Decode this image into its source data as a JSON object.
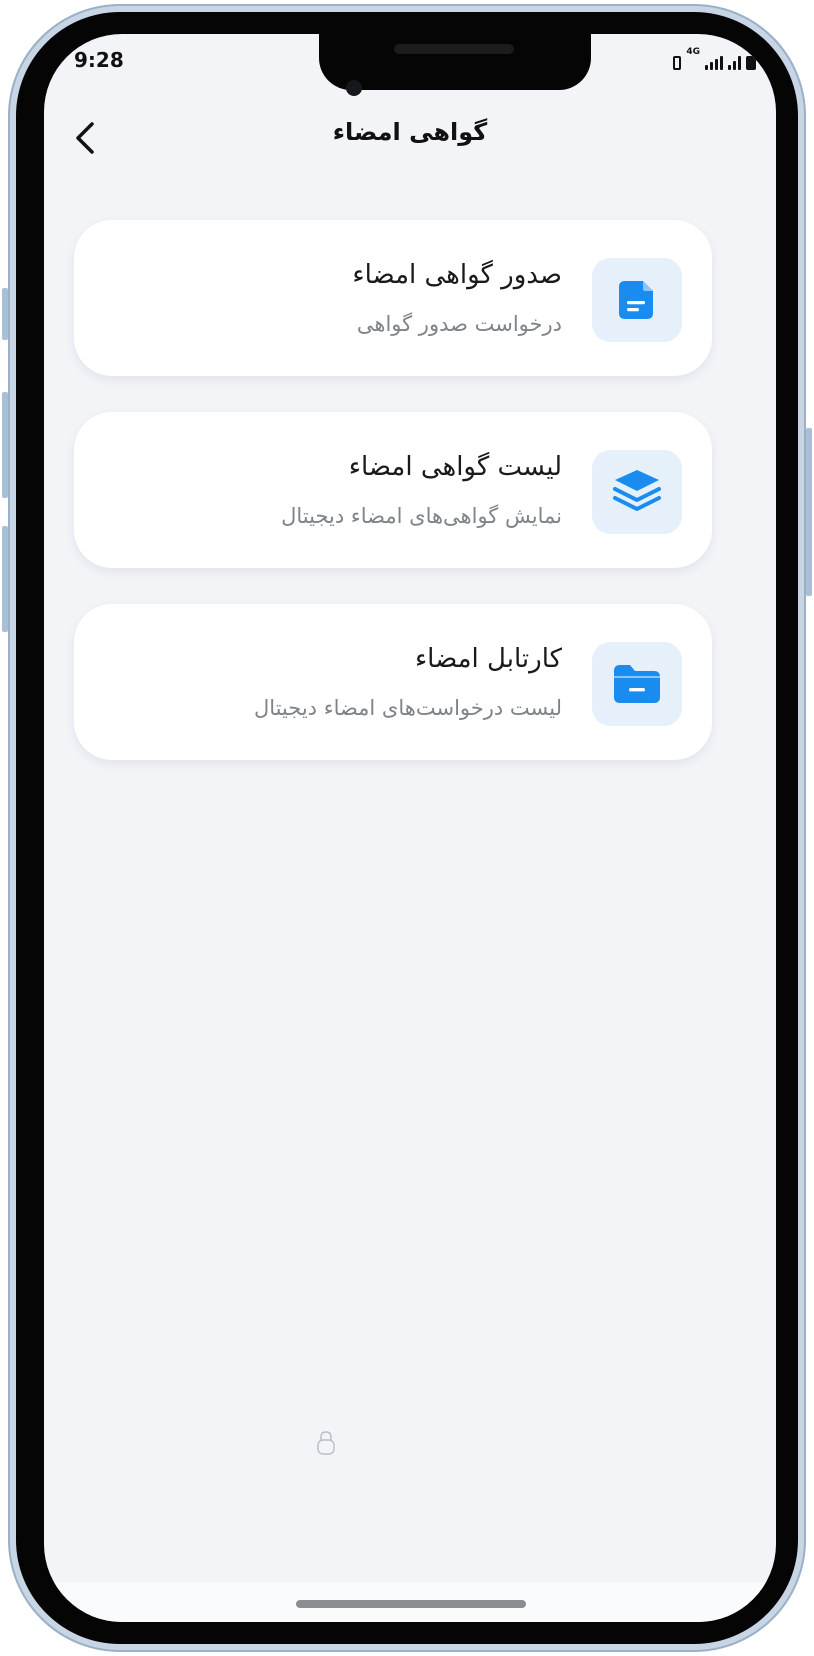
{
  "status_bar": {
    "time": "9:28",
    "network": "4G"
  },
  "header": {
    "title": "گواهی امضاء",
    "back_icon": "chevron-left-icon"
  },
  "menu": {
    "items": [
      {
        "title": "صدور گواهی امضاء",
        "subtitle": "درخواست صدور گواهی",
        "icon": "document-icon"
      },
      {
        "title": "لیست گواهی امضاء",
        "subtitle": "نمایش گواهی‌های امضاء دیجیتال",
        "icon": "layers-icon"
      },
      {
        "title": "کارتابل امضاء",
        "subtitle": "لیست درخواست‌های امضاء دیجیتال",
        "icon": "folder-icon"
      }
    ]
  },
  "colors": {
    "accent": "#1a8cf0",
    "icon_bg": "#e6f0fb",
    "background": "#f2f4f8",
    "card": "#ffffff"
  }
}
